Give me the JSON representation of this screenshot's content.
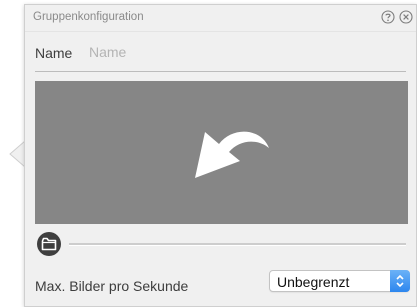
{
  "window": {
    "title": "Gruppenkonfiguration"
  },
  "controls": {
    "help_icon": "question-circle",
    "close_icon": "x-circle"
  },
  "name_field": {
    "label": "Name",
    "value": "",
    "placeholder": "Name"
  },
  "image_drop": {
    "icon": "curved-arrow-down-left",
    "background_color": "#868686"
  },
  "folder_button": {
    "icon": "folder-circle"
  },
  "fps": {
    "label": "Max. Bilder pro Sekunde",
    "selected": "Unbegrenzt",
    "accent_color": "#3f8ef0"
  }
}
